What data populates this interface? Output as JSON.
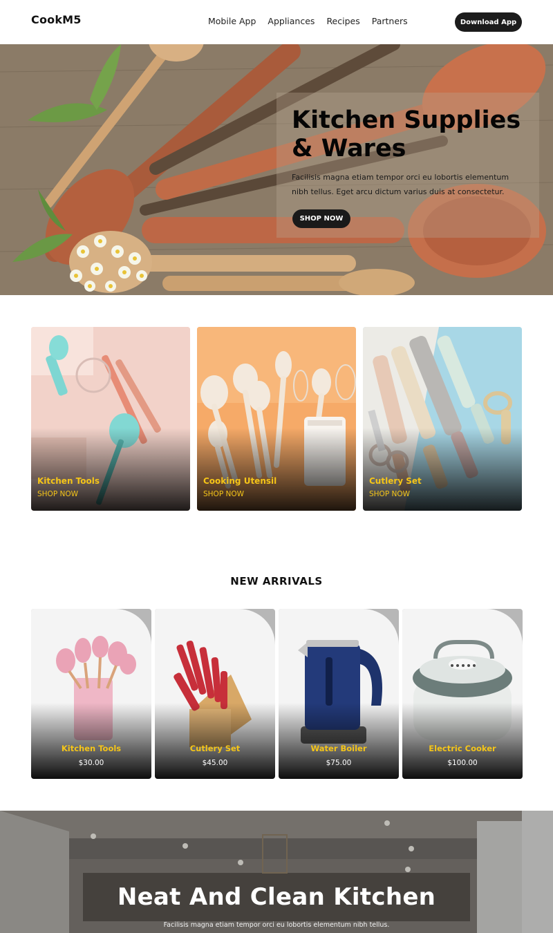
{
  "header": {
    "brand": "CookM5",
    "nav": [
      "Mobile App",
      "Appliances",
      "Recipes",
      "Partners"
    ],
    "cta": "Download App"
  },
  "hero": {
    "title": "Kitchen Supplies & Wares",
    "description": "Facilisis magna etiam tempor orci eu lobortis elementum nibh tellus. Eget arcu dictum varius duis at consectetur.",
    "button": "SHOP NOW"
  },
  "categories": [
    {
      "title": "Kitchen Tools",
      "link": "SHOP NOW"
    },
    {
      "title": "Cooking Utensil",
      "link": "SHOP NOW"
    },
    {
      "title": "Cutlery Set",
      "link": "SHOP NOW"
    }
  ],
  "arrivals": {
    "title": "NEW ARRIVALS",
    "products": [
      {
        "name": "Kitchen Tools",
        "price": "$30.00"
      },
      {
        "name": "Cutlery Set",
        "price": "$45.00"
      },
      {
        "name": "Water Boiler",
        "price": "$75.00"
      },
      {
        "name": "Electric Cooker",
        "price": "$100.00"
      }
    ]
  },
  "banner": {
    "title": "Neat And Clean Kitchen",
    "description": "Facilisis magna etiam tempor orci eu lobortis elementum nibh tellus."
  },
  "colors": {
    "accent": "#f5c518",
    "dark": "#1c1c1c"
  }
}
